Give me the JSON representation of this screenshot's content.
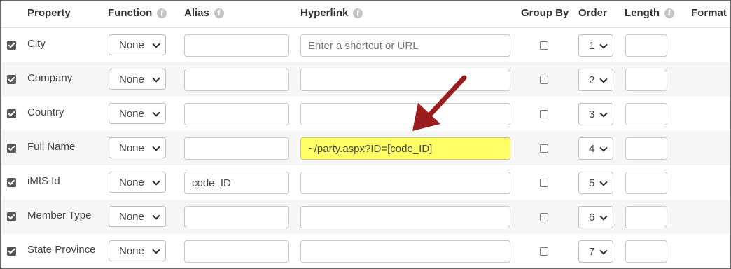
{
  "headers": {
    "property": "Property",
    "function": "Function",
    "alias": "Alias",
    "hyperlink": "Hyperlink",
    "group_by": "Group By",
    "order": "Order",
    "length": "Length",
    "format": "Format"
  },
  "info_glyph": "i",
  "rows": [
    {
      "property": "City",
      "function": "None",
      "alias": "",
      "hyperlink": "",
      "hyperlink_placeholder": "Enter a shortcut or URL",
      "group_by": false,
      "order": "1",
      "length": ""
    },
    {
      "property": "Company",
      "function": "None",
      "alias": "",
      "hyperlink": "",
      "group_by": false,
      "order": "2",
      "length": ""
    },
    {
      "property": "Country",
      "function": "None",
      "alias": "",
      "hyperlink": "",
      "group_by": false,
      "order": "3",
      "length": ""
    },
    {
      "property": "Full Name",
      "function": "None",
      "alias": "",
      "hyperlink": "~/party.aspx?ID=[code_ID]",
      "group_by": false,
      "order": "4",
      "length": ""
    },
    {
      "property": "iMIS Id",
      "function": "None",
      "alias": "code_ID",
      "hyperlink": "",
      "group_by": false,
      "order": "5",
      "length": ""
    },
    {
      "property": "Member Type",
      "function": "None",
      "alias": "",
      "hyperlink": "",
      "group_by": false,
      "order": "6",
      "length": ""
    },
    {
      "property": "State Province",
      "function": "None",
      "alias": "",
      "hyperlink": "",
      "group_by": false,
      "order": "7",
      "length": ""
    }
  ],
  "colors": {
    "highlight": "#ffff66",
    "annotation_arrow": "#9b1c1c",
    "checkbox": "#555555"
  },
  "annotation": {
    "icon": "arrow-annotation-icon",
    "points_to": "Full Name hyperlink"
  }
}
